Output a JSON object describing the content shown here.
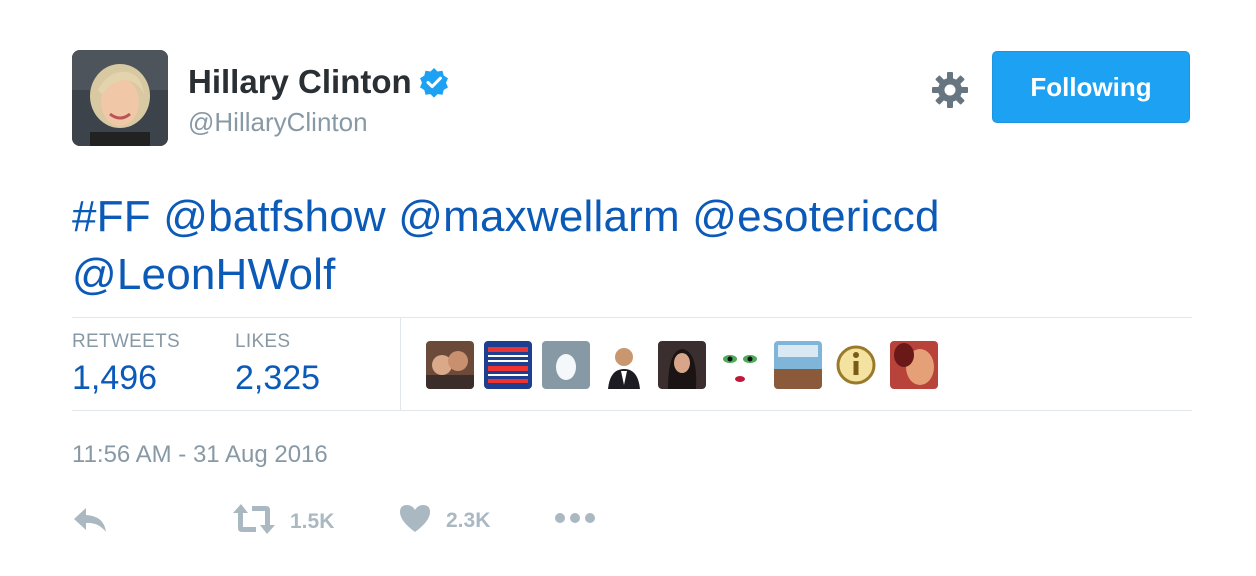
{
  "author": {
    "name": "Hillary Clinton",
    "handle": "@HillaryClinton",
    "verified": true
  },
  "header": {
    "follow_label": "Following",
    "accent_color": "#1da1f2"
  },
  "tweet": {
    "parts": [
      "#FF",
      "@batfshow",
      "@maxwellarm",
      "@esotericcd",
      "@LeonHWolf"
    ]
  },
  "stats": {
    "retweets_label": "RETWEETS",
    "retweets_value": "1,496",
    "likes_label": "LIKES",
    "likes_value": "2,325"
  },
  "timestamp": "11:56 AM - 31 Aug 2016",
  "actions": {
    "retweet_count": "1.5K",
    "like_count": "2.3K"
  },
  "icons": [
    "gear-icon",
    "verified-icon",
    "reply-icon",
    "retweet-icon",
    "heart-icon",
    "more-icon"
  ],
  "colors": {
    "link": "#0b5ab8",
    "muted": "#8899a6",
    "action": "#aab8c2"
  }
}
